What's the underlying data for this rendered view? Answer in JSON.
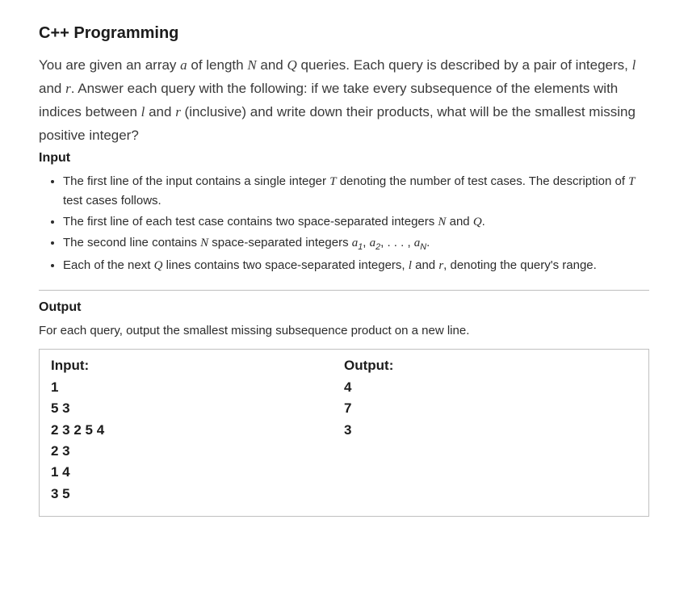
{
  "title": "C++ Programming",
  "description_parts": {
    "pre_a": "You are given an array ",
    "a": "a",
    "mid1": " of length ",
    "N": "N",
    "mid2": " and ",
    "Q": "Q",
    "mid3": " queries. Each query is described by a pair of integers, ",
    "l": "l",
    "mid4": " and ",
    "r": "r",
    "mid5": ". Answer each query with the following: if we take every subsequence of the elements with indices between ",
    "l2": "l",
    "mid6": " and ",
    "r2": "r",
    "post": " (inclusive) and write down their products, what will be the smallest missing positive integer?"
  },
  "input_heading": "Input",
  "input_bullets": {
    "b1": {
      "pre": "The first line of the input contains a single integer ",
      "T": "T",
      "mid": " denoting the number of test cases. The description of ",
      "T2": "T",
      "post": " test cases follows."
    },
    "b2": {
      "pre": "The first line of each test case contains two space-separated integers ",
      "N": "N",
      "mid": " and ",
      "Q": "Q",
      "post": "."
    },
    "b3": {
      "pre": "The second line contains ",
      "N": "N",
      "mid": " space-separated integers ",
      "a": "a",
      "s1": "1",
      "c1": ", ",
      "a2": "a",
      "s2": "2",
      "c2": ", . . . , ",
      "a3": "a",
      "s3": "N",
      "post": "."
    },
    "b4": {
      "pre": "Each of the next ",
      "Q": "Q",
      "mid": " lines contains two space-separated integers, ",
      "l": "l",
      "mid2": " and ",
      "r": "r",
      "post": ", denoting the query's range."
    }
  },
  "output_heading": "Output",
  "output_desc": "For each query, output the smallest missing subsequence product on a new line.",
  "example": {
    "input_label": "Input:",
    "output_label": "Output:",
    "input_lines": "1\n5 3\n2 3 2 5 4\n2 3\n1 4\n3 5",
    "output_lines": "4\n7\n3"
  }
}
